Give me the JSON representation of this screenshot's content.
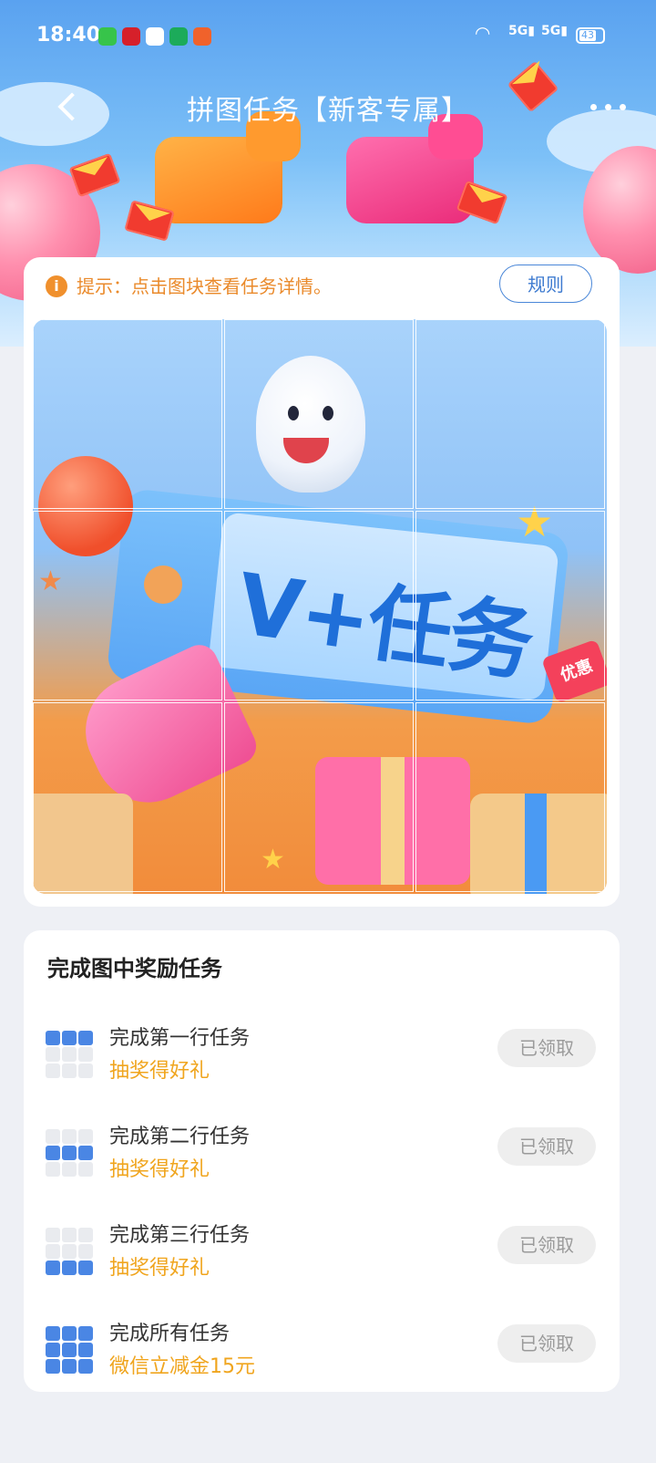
{
  "status_bar": {
    "time": "18:40",
    "battery": "43",
    "network": "5G"
  },
  "nav": {
    "title": "拼图任务【新客专属】"
  },
  "puzzle": {
    "tip": "提示：点击图块查看任务详情。",
    "rule_button": "规则",
    "banner_text": "V+任务",
    "tag_text": "优惠"
  },
  "tasks": {
    "heading": "完成图中奖励任务",
    "items": [
      {
        "title": "完成第一行任务",
        "reward": "抽奖得好礼",
        "button": "已领取"
      },
      {
        "title": "完成第二行任务",
        "reward": "抽奖得好礼",
        "button": "已领取"
      },
      {
        "title": "完成第三行任务",
        "reward": "抽奖得好礼",
        "button": "已领取"
      },
      {
        "title": "完成所有任务",
        "reward": "微信立减金15元",
        "button": "已领取"
      }
    ]
  },
  "colors": {
    "accent": "#4a86e4",
    "reward": "#f0a51e",
    "tip": "#ea8a2b"
  }
}
